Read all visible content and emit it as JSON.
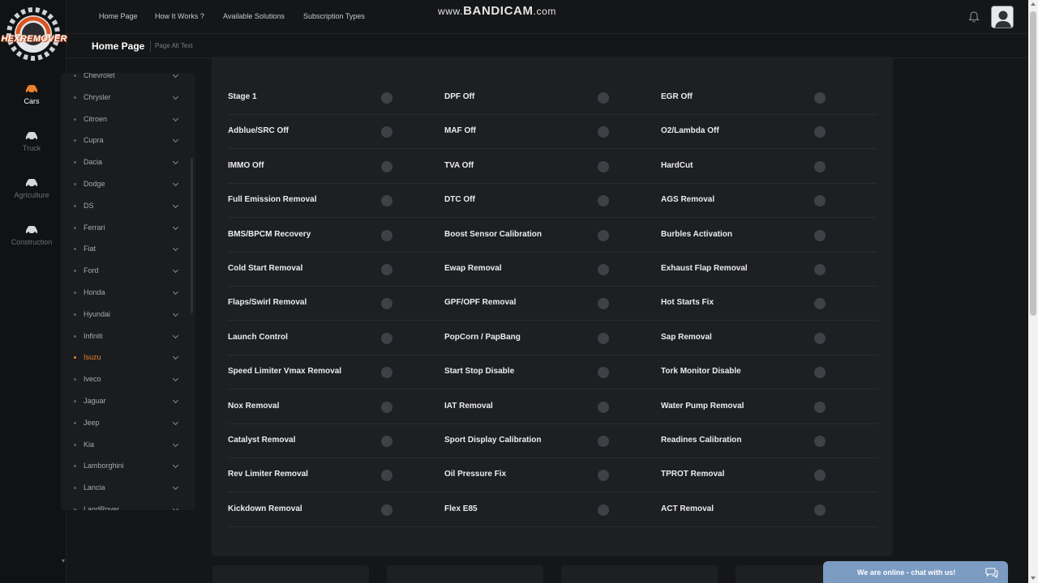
{
  "logo": {
    "text": "HEXREMOVER"
  },
  "rail": {
    "items": [
      {
        "label": "Cars",
        "icon": "car-icon",
        "active": true
      },
      {
        "label": "Truck",
        "icon": "truck-icon",
        "active": false
      },
      {
        "label": "Agriculture",
        "icon": "tractor-icon",
        "active": false
      },
      {
        "label": "Construction",
        "icon": "construction-icon",
        "active": false
      }
    ]
  },
  "nav": {
    "links": [
      "Home Page",
      "How It Works ?",
      "Available Solutions",
      "Subscription Types"
    ]
  },
  "watermark": {
    "prefix": "www.",
    "brand": "BANDICAM",
    "suffix": ".com"
  },
  "breadcrumb": {
    "title": "Home Page",
    "subtitle": "Page Alt Text"
  },
  "brands": {
    "items": [
      "Chevrolet",
      "Chrysler",
      "Citroen",
      "Cupra",
      "Dacia",
      "Dodge",
      "DS",
      "Ferrari",
      "Fiat",
      "Ford",
      "Honda",
      "Hyundai",
      "Infiniti",
      "Isuzu",
      "Iveco",
      "Jaguar",
      "Jeep",
      "Kia",
      "Lamborghini",
      "Lancia",
      "LandRover"
    ],
    "active": "Isuzu"
  },
  "options": {
    "rows": [
      [
        "Stage 1",
        "DPF Off",
        "EGR Off"
      ],
      [
        "Adblue/SRC Off",
        "MAF Off",
        "O2/Lambda Off"
      ],
      [
        "IMMO Off",
        "TVA Off",
        "HardCut"
      ],
      [
        "Full Emission Removal",
        "DTC Off",
        "AGS Removal"
      ],
      [
        "BMS/BPCM Recovery",
        "Boost Sensor Calibration",
        "Burbles Activation"
      ],
      [
        "Cold Start Removal",
        "Ewap Removal",
        "Exhaust Flap Removal"
      ],
      [
        "Flaps/Swirl Removal",
        "GPF/OPF Removal",
        "Hot Starts Fix"
      ],
      [
        "Launch Control",
        "PopCorn / PapBang",
        "Sap Removal"
      ],
      [
        "Speed Limiter Vmax Removal",
        "Start Stop Disable",
        "Tork Monitor Disable"
      ],
      [
        "Nox Removal",
        "IAT Removal",
        "Water Pump Removal"
      ],
      [
        "Catalyst Removal",
        "Sport Display Calibration",
        "Readines Calibration"
      ],
      [
        "Rev Limiter Removal",
        "Oil Pressure Fix",
        "TPROT Removal"
      ],
      [
        "Kickdown Removal",
        "Flex E85",
        "ACT Removal"
      ]
    ],
    "all_enabled": false
  },
  "chat": {
    "label": "We are online - chat with us!"
  },
  "colors": {
    "accent": "#e8812f",
    "background": "#151618",
    "card": "#1d1f22",
    "chat": "#7c9bc2"
  }
}
